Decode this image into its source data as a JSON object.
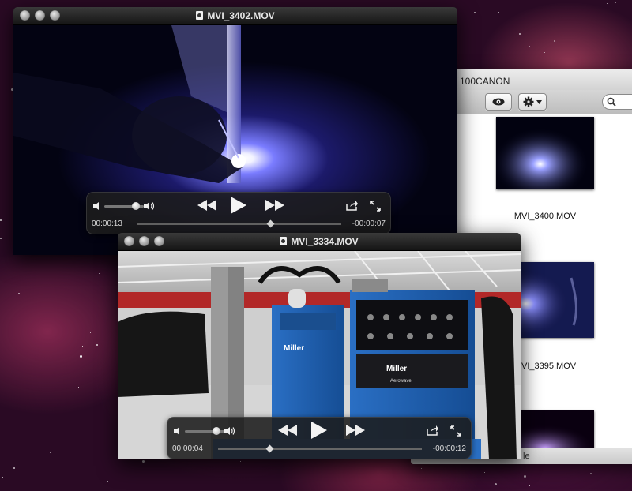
{
  "finder": {
    "title": "100CANON",
    "files": [
      {
        "name": "MVI_3400.MOV"
      },
      {
        "name": "MVI_3395.MOV"
      },
      {
        "name": ""
      }
    ],
    "status_text": "le",
    "icons": {
      "quicklook": "eye-icon",
      "action": "gear-icon",
      "search": "search-icon"
    }
  },
  "players": [
    {
      "title": "MVI_3402.MOV",
      "elapsed": "00:00:13",
      "remaining": "-00:00:07",
      "progress": 0.65,
      "volume": 0.7
    },
    {
      "title": "MVI_3334.MOV",
      "elapsed": "00:00:04",
      "remaining": "-00:00:12",
      "progress": 0.25,
      "volume": 0.7
    }
  ],
  "colors": {
    "hud_bg": "#1c1c1c",
    "finder_bg": "#ffffff",
    "nebula": "#2a0a24",
    "weld_glow": "#c8c8ff",
    "miller_blue": "#1d5fb0"
  }
}
